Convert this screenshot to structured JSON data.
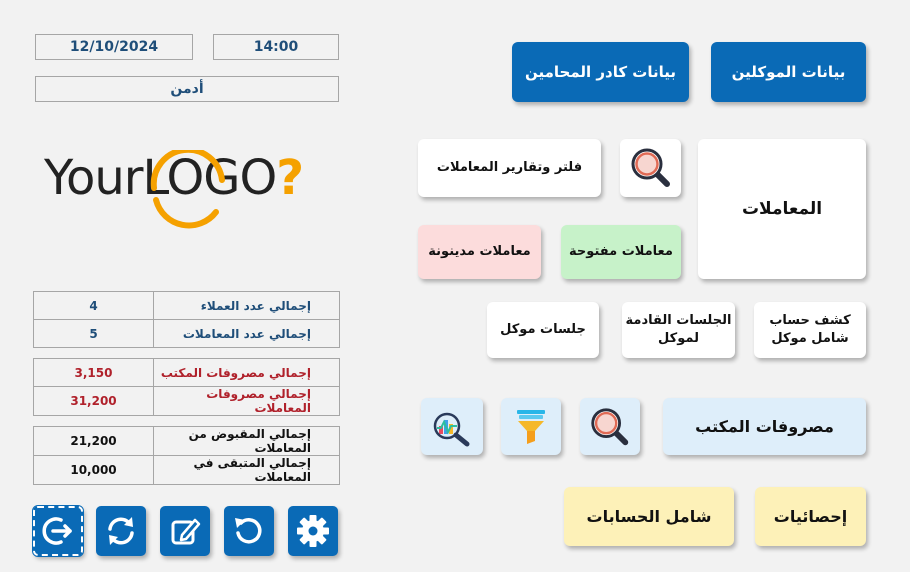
{
  "header": {
    "date": "12/10/2024",
    "time": "14:00",
    "user": "أدمن"
  },
  "logo": {
    "part1": "Your",
    "part2": "LOGO",
    "part3": "?"
  },
  "stats": {
    "group1": [
      {
        "label": "إجمالي عدد العملاء",
        "value": "4"
      },
      {
        "label": "إجمالي عدد المعاملات",
        "value": "5"
      }
    ],
    "group2": [
      {
        "label": "إجمالي مصروفات المكتب",
        "value": "3,150"
      },
      {
        "label": "إجمالي مصروفات المعاملات",
        "value": "31,200"
      }
    ],
    "group3": [
      {
        "label": "إجمالي المقبوض من المعاملات",
        "value": "21,200"
      },
      {
        "label": "إجمالي المتبقى في المعاملات",
        "value": "10,000"
      }
    ]
  },
  "tools": [
    "logout-icon",
    "sync-icon",
    "edit-icon",
    "refresh-icon",
    "settings-icon"
  ],
  "nav": {
    "clients": "بيانات الموكلين",
    "lawyers": "بيانات كادر المحامين",
    "transactions": "المعاملات",
    "filter_reports": "فلتر وتقارير المعاملات",
    "open_transactions": "معاملات مفتوحة",
    "debt_transactions": "معاملات مدينونة",
    "client_statement_line1": "كشف حساب",
    "client_statement_line2": "شامل موكل",
    "upcoming_line1": "الجلسات القادمة",
    "upcoming_line2": "لموكل",
    "client_sessions": "جلسات موكل",
    "office_expenses": "مصروفات المكتب",
    "statistics": "إحصائيات",
    "all_accounts": "شامل الحسابات"
  },
  "colors": {
    "primary": "#0a6ab6",
    "info_text": "#1f4e79",
    "expense_text": "#b0212b",
    "logo_orange": "#f5a100",
    "logo_dark": "#222222"
  }
}
